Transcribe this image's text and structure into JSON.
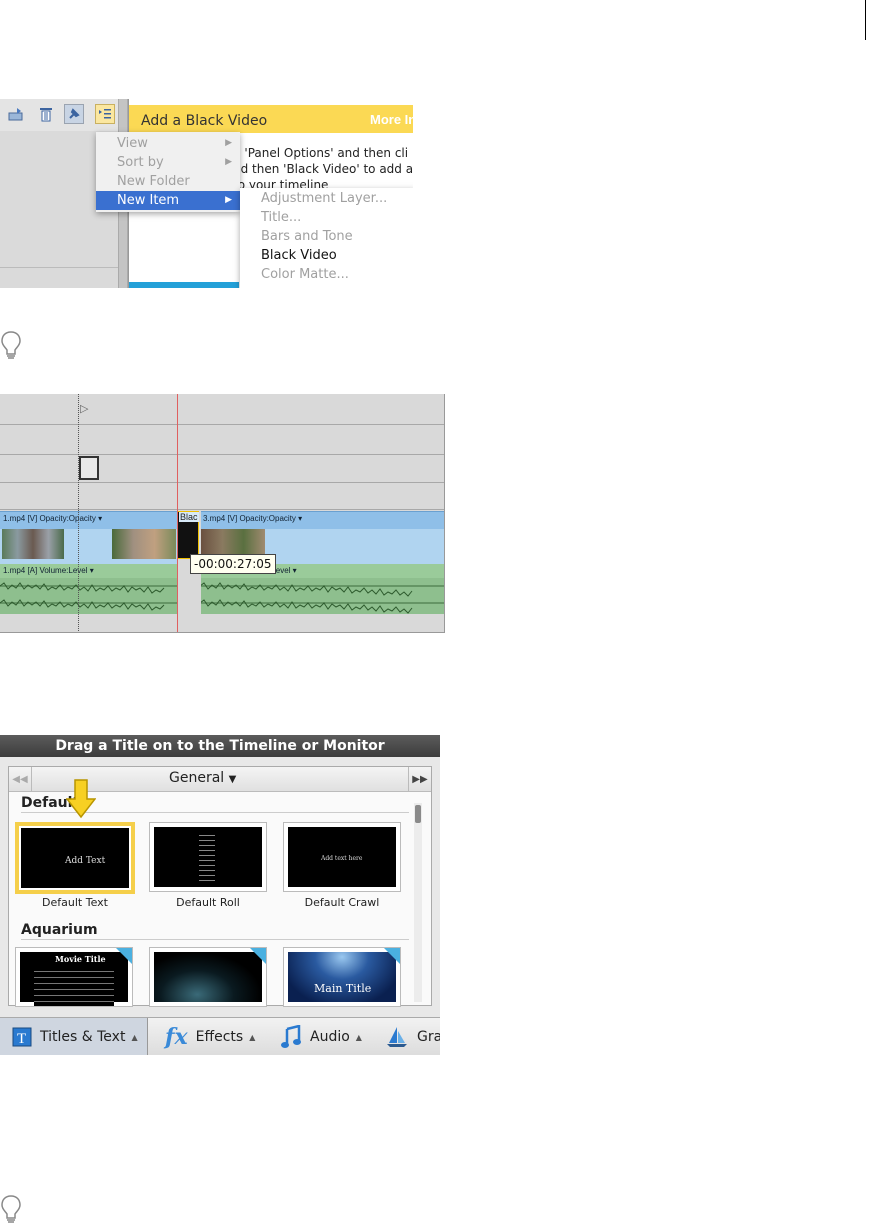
{
  "screenshot1": {
    "hint_title": "Add a Black Video",
    "hint_more": "More Info",
    "hint_text_lines": [
      "n 'Panel Options' and then cli",
      "nd then 'Black Video' to add a",
      "to your timeline"
    ],
    "menu": {
      "items": [
        {
          "label": "View",
          "has_submenu": true,
          "selected": false
        },
        {
          "label": "Sort by",
          "has_submenu": true,
          "selected": false
        },
        {
          "label": "New Folder",
          "has_submenu": false,
          "selected": false
        },
        {
          "label": "New Item",
          "has_submenu": true,
          "selected": true
        }
      ],
      "submenu": [
        {
          "label": "Adjustment Layer...",
          "enabled": false
        },
        {
          "label": "Title...",
          "enabled": false
        },
        {
          "label": "Bars and Tone",
          "enabled": false
        },
        {
          "label": "Black Video",
          "enabled": true
        },
        {
          "label": "Color Matte...",
          "enabled": false
        }
      ]
    },
    "toolbar_icons": [
      "export-icon",
      "trash-icon",
      "pin-icon",
      "panel-menu-icon"
    ]
  },
  "screenshot2": {
    "video_track_label_1": "1.mp4 [V]  Opacity:Opacity ▾",
    "video_track_label_2": "3.mp4 [V]  Opacity:Opacity ▾",
    "audio_track_label_1": "1.mp4 [A]  Volume:Level ▾",
    "audio_track_label_2": "me:Level ▾",
    "black_clip_label": "Blac",
    "tooltip": "-00:00:27:05"
  },
  "screenshot3": {
    "header": "Drag a Title on to the Timeline or Monitor",
    "category": "General",
    "sections": [
      {
        "name": "Default",
        "tiles": [
          {
            "name": "Default Text",
            "preview_text": "Add Text",
            "selected": true
          },
          {
            "name": "Default Roll",
            "preview_text": "",
            "selected": false
          },
          {
            "name": "Default Crawl",
            "preview_text": "Add text here",
            "selected": false
          }
        ]
      },
      {
        "name": "Aquarium",
        "tiles": [
          {
            "name": "",
            "preview_text": "Movie Title"
          },
          {
            "name": "",
            "preview_text": ""
          },
          {
            "name": "",
            "preview_text": "Main Title"
          }
        ]
      }
    ],
    "tabs": [
      {
        "label": "Titles & Text",
        "icon": "titles-text-icon"
      },
      {
        "label": "Effects",
        "icon": "fx-icon"
      },
      {
        "label": "Audio",
        "icon": "music-note-icon"
      },
      {
        "label": "Gra",
        "icon": "sailboat-icon"
      }
    ]
  },
  "colors": {
    "menu_highlight": "#3a70d0",
    "hint_header": "#fbd954",
    "selected_tile_border": "#f5cf4a",
    "playhead": "#e06060"
  }
}
